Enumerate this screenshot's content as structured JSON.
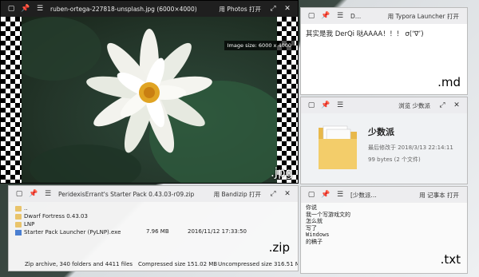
{
  "photo_window": {
    "title": "ruben-ortega-227818-unsplash.jpg (6000×4000)",
    "open_label": "用 Photos 打开",
    "image_size": "Image size: 6000 x 4000",
    "ext": ".jpg",
    "icons": [
      "window-icon",
      "pin-icon",
      "menu-icon",
      "fullscreen-icon",
      "close-icon"
    ]
  },
  "md_window": {
    "title": "D…",
    "open_label": "用 Typora Launcher 打开",
    "content": "其实是我 DerQi 哒AAAA！！！ σ(‘∇’)",
    "ext": ".md"
  },
  "folder_window": {
    "open_label": "浏览 少数派",
    "name": "少数派",
    "modified": "最后修改于 2018/3/13 22:14:11",
    "size": "99 bytes (2 个文件)"
  },
  "zip_window": {
    "title": "PeridexisErrant's Starter Pack 0.43.03-r09.zip",
    "open_label": "用 Bandizip 打开",
    "rows": [
      {
        "name": "..",
        "type": "folder",
        "size": "",
        "date": ""
      },
      {
        "name": "Dwarf Fortress 0.43.03",
        "type": "folder",
        "size": "",
        "date": ""
      },
      {
        "name": "LNP",
        "type": "folder",
        "size": "",
        "date": ""
      },
      {
        "name": "Starter Pack Launcher (PyLNP).exe",
        "type": "exe",
        "size": "7.96 MB",
        "date": "2016/11/12 17:33:50"
      }
    ],
    "ext": ".zip",
    "footer_summary": "Zip archive, 340 folders and 4411 files",
    "footer_compressed": "Compressed size 151.02 MB",
    "footer_uncompressed": "Uncompressed size 316.51 MB"
  },
  "txt_window": {
    "title": "[少数派…",
    "open_label": "用 记事本 打开",
    "lines": [
      "你说",
      "我一个写游戏文的",
      "怎么就",
      "写了",
      "Windows",
      "的稿子"
    ],
    "ext": ".txt"
  }
}
